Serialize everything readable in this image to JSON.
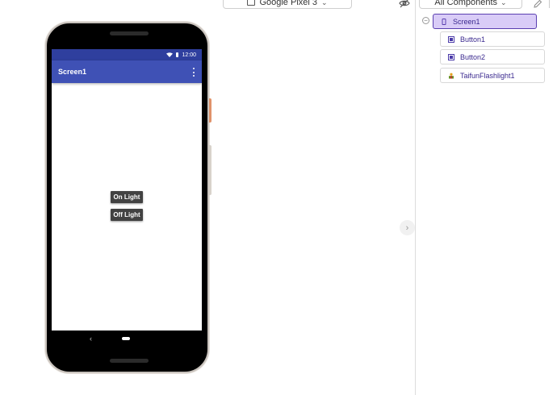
{
  "toolbar": {
    "device_label": "Google Pixel 3",
    "device_icon": "device-icon",
    "hide_icon": "eye-off-icon"
  },
  "components_panel": {
    "filter_label": "All Components",
    "edit_icon": "pencil-icon"
  },
  "tree": {
    "root": {
      "label": "Screen1",
      "icon": "phone-icon",
      "selected": true
    },
    "children": [
      {
        "label": "Button1",
        "icon": "button-icon"
      },
      {
        "label": "Button2",
        "icon": "button-icon"
      },
      {
        "label": "TaifunFlashlight1",
        "icon": "flashlight-extension-icon"
      }
    ]
  },
  "phone": {
    "status_time": "12:00",
    "app_title": "Screen1",
    "buttons": [
      {
        "label": "On Light"
      },
      {
        "label": "Off Light"
      }
    ],
    "nav_back": "‹"
  },
  "colors": {
    "status_bar": "#2f3f9e",
    "app_bar": "#3f51b5",
    "button_bg": "#424242",
    "selected_node_bg": "#d9ccf7",
    "selected_node_border": "#5a3fb0",
    "tree_text": "#3b2a8f"
  }
}
